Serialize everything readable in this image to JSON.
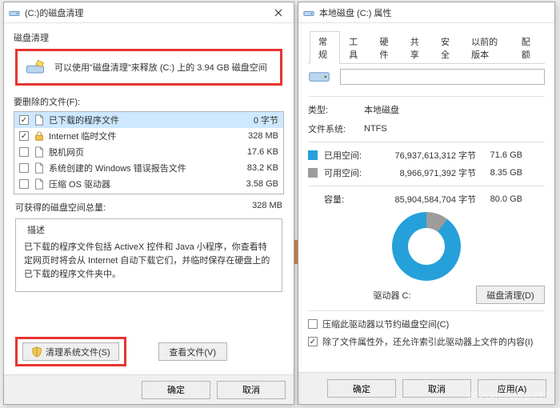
{
  "cleanup": {
    "title": "(C:)的磁盘清理",
    "heading": "磁盘清理",
    "summary": "可以使用\"磁盘清理\"来释放  (C:) 上的 3.94 GB 磁盘空间",
    "filesLabel": "要删除的文件(F):",
    "rows": [
      {
        "icon": "file",
        "checked": true,
        "name": "已下载的程序文件",
        "size": "0 字节",
        "selected": true
      },
      {
        "icon": "lock",
        "checked": true,
        "name": "Internet 临时文件",
        "size": "328 MB",
        "selected": false
      },
      {
        "icon": "file",
        "checked": false,
        "name": "脱机网页",
        "size": "17.6 KB",
        "selected": false
      },
      {
        "icon": "file",
        "checked": false,
        "name": "系统创建的 Windows 错误报告文件",
        "size": "83.2 KB",
        "selected": false
      },
      {
        "icon": "file",
        "checked": false,
        "name": "压缩 OS 驱动器",
        "size": "3.58 GB",
        "selected": false
      }
    ],
    "totalLabel": "可获得的磁盘空间总量:",
    "totalSize": "328 MB",
    "descHeading": "描述",
    "descText": "已下载的程序文件包括 ActiveX 控件和 Java 小程序，你查看特定网页时将会从 Internet 自动下载它们，并临时保存在硬盘上的已下载的程序文件夹中。",
    "sysBtn": "清理系统文件(S)",
    "viewBtn": "查看文件(V)",
    "ok": "确定",
    "cancel": "取消"
  },
  "props": {
    "title": "本地磁盘 (C:) 属性",
    "tabs": [
      "常规",
      "工具",
      "硬件",
      "共享",
      "安全",
      "以前的版本",
      "配额"
    ],
    "activeTab": 0,
    "typeLabel": "类型:",
    "typeValue": "本地磁盘",
    "fsLabel": "文件系统:",
    "fsValue": "NTFS",
    "used": {
      "label": "已用空间:",
      "bytes": "76,937,613,312 字节",
      "gb": "71.6 GB",
      "color": "#26a0da"
    },
    "free": {
      "label": "可用空间:",
      "bytes": "8,966,971,392 字节",
      "gb": "8.35 GB",
      "color": "#9c9c9c"
    },
    "cap": {
      "label": "容量:",
      "bytes": "85,904,584,704 字节",
      "gb": "80.0 GB"
    },
    "driveLabel": "驱动器 C:",
    "cleanupBtn": "磁盘清理(D)",
    "compress": {
      "checked": false,
      "label": "压缩此驱动器以节约磁盘空间(C)"
    },
    "index": {
      "checked": true,
      "label": "除了文件属性外，还允许索引此驱动器上文件的内容(I)"
    },
    "ok": "确定",
    "cancel": "取消",
    "apply": "应用(A)"
  },
  "stamp": "jingyan.baidu.com"
}
